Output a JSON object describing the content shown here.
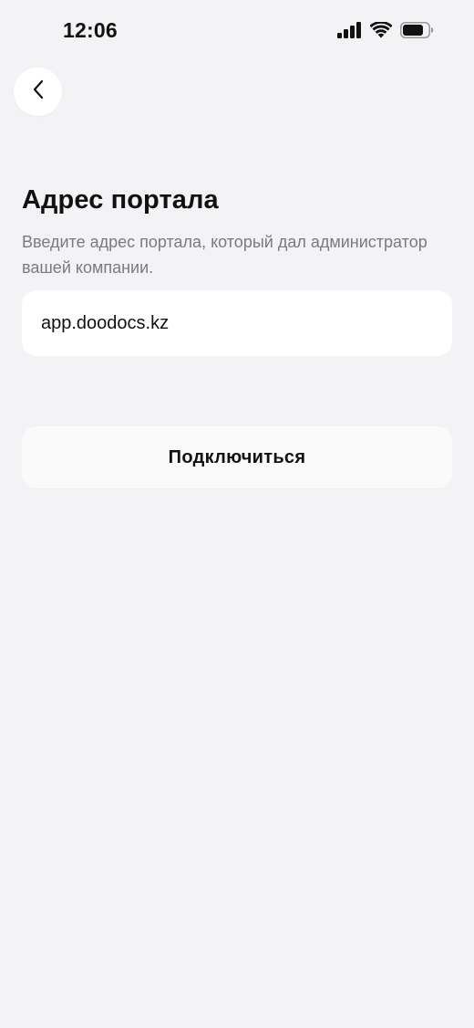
{
  "status_bar": {
    "time": "12:06",
    "icons": [
      "cellular-signal-icon",
      "wifi-icon",
      "battery-icon"
    ]
  },
  "nav": {
    "back_icon": "chevron-left-icon"
  },
  "main": {
    "title": "Адрес портала",
    "description": "Введите адрес портала, который дал администратор вашей компании.",
    "portal_input": {
      "value": "app.doodocs.kz",
      "placeholder": ""
    },
    "connect_button_label": "Подключиться"
  },
  "colors": {
    "background": "#f3f3f5",
    "card": "#ffffff",
    "text_primary": "#111111",
    "text_secondary": "#7a7a80"
  }
}
